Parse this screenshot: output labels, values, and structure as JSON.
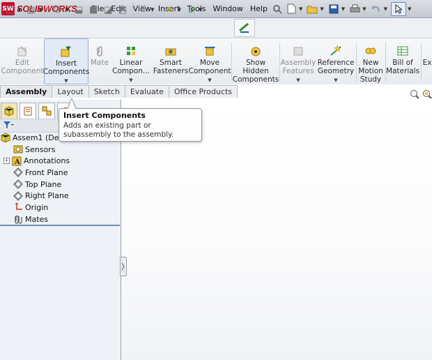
{
  "app": {
    "logo_text": "SOLIDWORKS",
    "logo_mark": "SW"
  },
  "menu": [
    "File",
    "Edit",
    "View",
    "Insert",
    "Tools",
    "Window",
    "Help"
  ],
  "quick_access_icons": [
    "pin-icon",
    "new-doc-icon",
    "open-folder-icon",
    "save-icon",
    "print-icon",
    "undo-icon",
    "select-pointer-icon"
  ],
  "toolbar2_icons": [
    "copy-icon",
    "paste-icon",
    "component-icon",
    "rebuild-icon",
    "display-icon",
    "grid-icon",
    "sketch-icon",
    "smart-dim-icon",
    "spline-icon",
    "measure-icon"
  ],
  "command_manager": {
    "edit_component": "Edit\nComponent",
    "insert_components": "Insert\nComponents",
    "mate": "Mate",
    "linear_component": "Linear\nCompon...",
    "smart_fasteners": "Smart\nFasteners",
    "move_component": "Move\nComponent",
    "show_hidden": "Show\nHidden\nComponents",
    "assembly_features": "Assembly\nFeatures",
    "reference_geometry": "Reference\nGeometry",
    "new_motion_study": "New\nMotion\nStudy",
    "bill_of_materials": "Bill of\nMaterials",
    "overflow": "Ex"
  },
  "tabs": [
    "Assembly",
    "Layout",
    "Sketch",
    "Evaluate",
    "Office Products"
  ],
  "active_tab": "Assembly",
  "tree": {
    "root": "Assem1  (Def",
    "items": [
      "Sensors",
      "Annotations",
      "Front Plane",
      "Top Plane",
      "Right Plane",
      "Origin",
      "Mates"
    ]
  },
  "tooltip": {
    "title": "Insert Components",
    "body": "Adds an existing part or subassembly to the assembly."
  },
  "colors": {
    "brand_red": "#c8102e",
    "active_highlight": "#e2eaf6",
    "tree_divider": "#6f90b8"
  }
}
